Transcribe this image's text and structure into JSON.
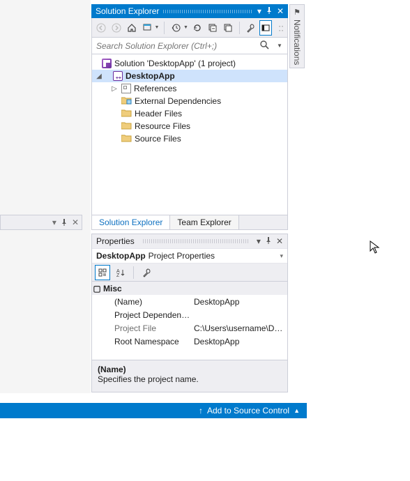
{
  "solution_explorer": {
    "title": "Solution Explorer",
    "search_placeholder": "Search Solution Explorer (Ctrl+;)",
    "solution_label": "Solution 'DesktopApp' (1 project)",
    "project_label": "DesktopApp",
    "nodes": {
      "references": "References",
      "external_deps": "External Dependencies",
      "header_files": "Header Files",
      "resource_files": "Resource Files",
      "source_files": "Source Files"
    },
    "tabs": {
      "solution": "Solution Explorer",
      "team": "Team Explorer"
    }
  },
  "properties": {
    "title": "Properties",
    "object": "DesktopApp",
    "object_type": "Project Properties",
    "category": "Misc",
    "rows": {
      "name_label": "(Name)",
      "name_value": "DesktopApp",
      "deps_label": "Project Dependencies",
      "deps_value": "",
      "file_label": "Project File",
      "file_value": "C:\\Users\\username\\Documents\\...",
      "ns_label": "Root Namespace",
      "ns_value": "DesktopApp"
    },
    "desc_title": "(Name)",
    "desc_text": "Specifies the project name."
  },
  "status_bar": {
    "source_control": "Add to Source Control"
  },
  "notifications": {
    "label": "Notifications"
  }
}
